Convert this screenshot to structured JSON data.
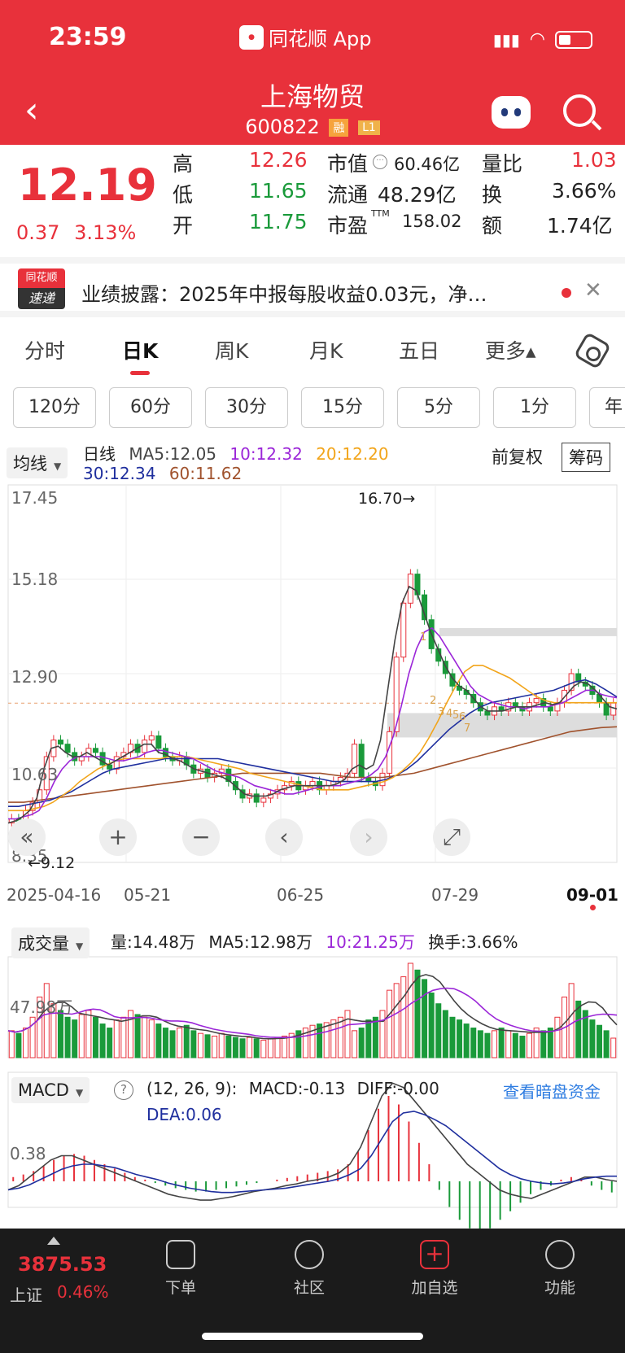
{
  "status": {
    "time": "23:59",
    "app": "同花顺 App"
  },
  "header": {
    "title": "上海物贸",
    "code": "600822",
    "tag1": "融",
    "tag2": "L1"
  },
  "quote": {
    "price": "12.19",
    "change": "0.37",
    "change_pct": "3.13%",
    "high_label": "高",
    "high": "12.26",
    "low_label": "低",
    "low": "11.65",
    "open_label": "开",
    "open": "11.75",
    "mcap_label": "市值",
    "mcap": "60.46亿",
    "float_label": "流通",
    "float": "48.29亿",
    "pe_label": "市盈",
    "pe_sup": "TTM",
    "pe": "158.02",
    "vr_label": "量比",
    "vr": "1.03",
    "turn_label": "换",
    "turn": "3.66%",
    "amt_label": "额",
    "amt": "1.74亿"
  },
  "news": {
    "logo_top": "同花顺",
    "logo_bottom": "速递",
    "text": "业绩披露：2025年中报每股收益0.03元，净…",
    "close": "✕"
  },
  "tabs": [
    {
      "label": "分时"
    },
    {
      "label": "日K"
    },
    {
      "label": "周K"
    },
    {
      "label": "月K"
    },
    {
      "label": "五日"
    },
    {
      "label": "更多▴"
    }
  ],
  "periods": [
    "120分",
    "60分",
    "30分",
    "15分",
    "5分",
    "1分",
    "年"
  ],
  "kline_legend": {
    "selector": "均线",
    "period": "日线",
    "ma5": "MA5:12.05",
    "ma10": "10:12.32",
    "ma20": "20:12.20",
    "ma30": "30:12.34",
    "ma60": "60:11.62",
    "adjust": "前复权",
    "chouma": "筹码"
  },
  "kline_axis": {
    "y_labels": [
      "17.45",
      "15.18",
      "12.90",
      "10.63",
      "8.35"
    ],
    "x_labels": [
      "2025-04-16",
      "05-21",
      "06-25",
      "07-29",
      "09-01"
    ],
    "high_mark": "16.70→",
    "low_mark": "←9.12",
    "cost_marks": [
      "1",
      "2",
      "3",
      "4",
      "5",
      "6",
      "7"
    ]
  },
  "volume_legend": {
    "selector": "成交量",
    "vol": "量:14.48万",
    "ma5": "MA5:12.98万",
    "ma10": "10:21.25万",
    "turnover": "换手:3.66%",
    "axis": "47.98万"
  },
  "macd_legend": {
    "selector": "MACD",
    "help": "?",
    "params": "(12, 26, 9):",
    "macd": "MACD:-0.13",
    "diff": "DIFF:-0.00",
    "dea": "DEA:0.06",
    "link": "查看暗盘资金",
    "axis": "0.38"
  },
  "controls": {
    "prev": "«",
    "zoom_in": "+",
    "zoom_out": "−",
    "left": "‹",
    "right": "›",
    "fullscreen": "⤢"
  },
  "bottom": {
    "index_value": "3875.53",
    "index_name": "上证",
    "index_change": "0.46%",
    "items": [
      {
        "label": "下单"
      },
      {
        "label": "社区"
      },
      {
        "label": "加自选"
      },
      {
        "label": "功能"
      }
    ]
  },
  "colors": {
    "up": "#e8313b",
    "down": "#1a9a3a",
    "ma5": "#444444",
    "ma10": "#9b26d8",
    "ma20": "#f2a51b",
    "ma30": "#1f2f9e",
    "ma60": "#a0522d"
  },
  "chart_data": {
    "type": "candlestick",
    "y_range": [
      8.35,
      17.45
    ],
    "price_line": 12.19,
    "x_labels": [
      "2025-04-16",
      "05-21",
      "06-25",
      "07-29",
      "09-01"
    ],
    "closes": [
      9.4,
      9.3,
      9.6,
      9.8,
      10.1,
      10.9,
      11.3,
      11.2,
      11.0,
      10.8,
      10.9,
      11.1,
      11.0,
      10.7,
      10.6,
      10.9,
      11.0,
      11.2,
      11.0,
      11.3,
      11.4,
      11.1,
      10.9,
      10.8,
      10.9,
      10.7,
      10.5,
      10.6,
      10.4,
      10.5,
      10.6,
      10.3,
      10.1,
      9.9,
      10.0,
      9.8,
      9.9,
      10.0,
      10.1,
      10.2,
      10.3,
      10.1,
      10.2,
      10.3,
      10.1,
      10.2,
      10.3,
      10.4,
      10.5,
      11.2,
      10.4,
      10.3,
      10.2,
      10.5,
      11.5,
      13.3,
      14.6,
      15.3,
      14.8,
      14.2,
      13.5,
      13.2,
      12.9,
      12.6,
      12.5,
      12.4,
      12.2,
      12.0,
      11.9,
      12.1,
      12.0,
      12.2,
      12.1,
      12.0,
      12.2,
      12.3,
      12.1,
      12.0,
      12.2,
      12.5,
      12.9,
      12.7,
      12.6,
      12.4,
      12.2,
      11.9,
      12.19
    ],
    "volumes": [
      20,
      18,
      22,
      30,
      45,
      55,
      40,
      35,
      30,
      28,
      32,
      35,
      30,
      25,
      22,
      28,
      30,
      35,
      32,
      30,
      28,
      25,
      22,
      20,
      22,
      24,
      20,
      18,
      17,
      16,
      18,
      16,
      15,
      14,
      15,
      14,
      13,
      14,
      15,
      16,
      18,
      20,
      22,
      24,
      25,
      26,
      28,
      30,
      35,
      20,
      22,
      28,
      30,
      35,
      50,
      55,
      60,
      70,
      65,
      58,
      48,
      40,
      35,
      30,
      28,
      25,
      22,
      20,
      18,
      20,
      22,
      20,
      18,
      16,
      18,
      22,
      20,
      22,
      30,
      45,
      55,
      42,
      35,
      28,
      24,
      20,
      14.48
    ],
    "ma5": [
      9.3,
      9.35,
      9.45,
      9.6,
      9.9,
      10.6,
      11.1,
      11.15,
      11.0,
      10.9,
      10.9,
      11.0,
      10.9,
      10.8,
      10.7,
      10.8,
      10.9,
      11.0,
      11.1,
      11.2,
      11.2,
      11.0,
      10.95,
      10.85,
      10.8,
      10.7,
      10.6,
      10.55,
      10.5,
      10.45,
      10.4,
      10.3,
      10.15,
      10.0,
      9.95,
      9.95,
      9.95,
      10.0,
      10.1,
      10.15,
      10.2,
      10.2,
      10.2,
      10.2,
      10.2,
      10.2,
      10.25,
      10.35,
      10.6,
      10.7,
      10.6,
      10.7,
      11.3,
      12.5,
      13.7,
      14.6,
      15.0,
      14.9,
      14.4,
      13.9,
      13.5,
      13.1,
      12.8,
      12.6,
      12.5,
      12.3,
      12.1,
      12.0,
      12.0,
      12.0,
      12.05,
      12.1,
      12.1,
      12.1,
      12.15,
      12.2,
      12.15,
      12.2,
      12.4,
      12.6,
      12.7,
      12.65,
      12.5,
      12.3,
      12.1,
      12.05
    ],
    "ma10": [
      9.4,
      9.4,
      9.45,
      9.5,
      9.6,
      9.9,
      10.3,
      10.6,
      10.8,
      10.9,
      10.9,
      10.9,
      10.9,
      10.85,
      10.8,
      10.8,
      10.85,
      10.9,
      11.0,
      11.05,
      11.05,
      11.0,
      10.95,
      10.9,
      10.85,
      10.75,
      10.65,
      10.55,
      10.5,
      10.45,
      10.4,
      10.3,
      10.2,
      10.15,
      10.1,
      10.05,
      10.0,
      10.0,
      10.05,
      10.1,
      10.15,
      10.2,
      10.2,
      10.2,
      10.25,
      10.3,
      10.35,
      10.45,
      10.6,
      10.9,
      11.4,
      12.1,
      12.9,
      13.5,
      13.9,
      14.0,
      13.8,
      13.5,
      13.2,
      12.9,
      12.6,
      12.4,
      12.3,
      12.2,
      12.15,
      12.1,
      12.1,
      12.05,
      12.1,
      12.1,
      12.1,
      12.15,
      12.2,
      12.3,
      12.4,
      12.5,
      12.5,
      12.4,
      12.35,
      12.32
    ],
    "ma20": [
      9.6,
      9.6,
      9.6,
      9.65,
      9.7,
      9.8,
      9.95,
      10.1,
      10.3,
      10.45,
      10.6,
      10.7,
      10.8,
      10.85,
      10.85,
      10.85,
      10.85,
      10.85,
      10.9,
      10.9,
      10.9,
      10.85,
      10.8,
      10.75,
      10.7,
      10.65,
      10.6,
      10.5,
      10.45,
      10.4,
      10.35,
      10.3,
      10.25,
      10.2,
      10.15,
      10.1,
      10.1,
      10.1,
      10.1,
      10.15,
      10.2,
      10.25,
      10.3,
      10.4,
      10.55,
      10.75,
      11.0,
      11.35,
      11.75,
      12.2,
      12.6,
      12.95,
      13.1,
      13.1,
      13.0,
      12.9,
      12.8,
      12.65,
      12.5,
      12.35,
      12.25,
      12.2,
      12.2,
      12.2,
      12.2,
      12.2,
      12.2,
      12.2,
      12.2
    ],
    "ma30": [
      9.7,
      9.7,
      9.75,
      9.8,
      9.85,
      9.95,
      10.05,
      10.2,
      10.35,
      10.5,
      10.6,
      10.65,
      10.7,
      10.75,
      10.8,
      10.85,
      10.85,
      10.85,
      10.85,
      10.85,
      10.85,
      10.8,
      10.75,
      10.7,
      10.65,
      10.6,
      10.55,
      10.5,
      10.45,
      10.4,
      10.35,
      10.3,
      10.3,
      10.3,
      10.3,
      10.3,
      10.35,
      10.45,
      10.6,
      10.8,
      11.05,
      11.3,
      11.55,
      11.75,
      11.95,
      12.1,
      12.2,
      12.25,
      12.3,
      12.35,
      12.4,
      12.45,
      12.5,
      12.6,
      12.7,
      12.75,
      12.65,
      12.5,
      12.34
    ],
    "ma60": [
      9.8,
      9.8,
      9.85,
      9.9,
      9.95,
      10.0,
      10.05,
      10.1,
      10.15,
      10.2,
      10.25,
      10.3,
      10.35,
      10.4,
      10.45,
      10.5,
      10.5,
      10.5,
      10.5,
      10.5,
      10.5,
      10.45,
      10.4,
      10.4,
      10.4,
      10.45,
      10.5,
      10.6,
      10.7,
      10.8,
      10.9,
      11.0,
      11.1,
      11.2,
      11.3,
      11.4,
      11.5,
      11.55,
      11.6,
      11.62
    ],
    "macd_hist": [
      0.05,
      0.08,
      0.12,
      0.18,
      0.25,
      0.3,
      0.32,
      0.3,
      0.25,
      0.2,
      0.15,
      0.1,
      0.05,
      0.02,
      -0.02,
      -0.05,
      -0.08,
      -0.1,
      -0.12,
      -0.12,
      -0.1,
      -0.08,
      -0.06,
      -0.04,
      -0.02,
      0.0,
      0.02,
      0.04,
      0.06,
      0.08,
      0.1,
      0.12,
      0.14,
      0.2,
      0.35,
      0.6,
      0.85,
      1.0,
      0.9,
      0.7,
      0.45,
      0.2,
      -0.1,
      -0.3,
      -0.45,
      -0.55,
      -0.6,
      -0.55,
      -0.45,
      -0.35,
      -0.25,
      -0.15,
      -0.1,
      -0.05,
      0.02,
      0.05,
      0.03,
      -0.05,
      -0.1,
      -0.13
    ],
    "macd_dif": [
      -0.1,
      -0.05,
      0.05,
      0.15,
      0.25,
      0.3,
      0.3,
      0.25,
      0.2,
      0.15,
      0.1,
      0.05,
      0.0,
      -0.05,
      -0.1,
      -0.15,
      -0.18,
      -0.2,
      -0.22,
      -0.22,
      -0.2,
      -0.18,
      -0.15,
      -0.12,
      -0.1,
      -0.08,
      -0.05,
      -0.03,
      0.0,
      0.02,
      0.05,
      0.1,
      0.2,
      0.4,
      0.7,
      1.0,
      1.15,
      1.1,
      0.95,
      0.8,
      0.65,
      0.5,
      0.35,
      0.2,
      0.1,
      0.0,
      -0.1,
      -0.15,
      -0.18,
      -0.2,
      -0.15,
      -0.1,
      -0.05,
      0.0,
      0.05,
      0.05,
      0.02,
      0.0
    ],
    "macd_dea": [
      -0.1,
      -0.08,
      -0.04,
      0.02,
      0.08,
      0.14,
      0.18,
      0.2,
      0.2,
      0.18,
      0.16,
      0.12,
      0.08,
      0.05,
      0.02,
      -0.02,
      -0.05,
      -0.08,
      -0.1,
      -0.12,
      -0.13,
      -0.13,
      -0.12,
      -0.11,
      -0.1,
      -0.09,
      -0.08,
      -0.06,
      -0.04,
      -0.02,
      0.0,
      0.03,
      0.08,
      0.15,
      0.3,
      0.5,
      0.7,
      0.8,
      0.82,
      0.78,
      0.72,
      0.65,
      0.55,
      0.45,
      0.35,
      0.25,
      0.15,
      0.08,
      0.03,
      0.0,
      -0.02,
      -0.03,
      -0.02,
      0.0,
      0.03,
      0.05,
      0.06,
      0.06
    ]
  }
}
